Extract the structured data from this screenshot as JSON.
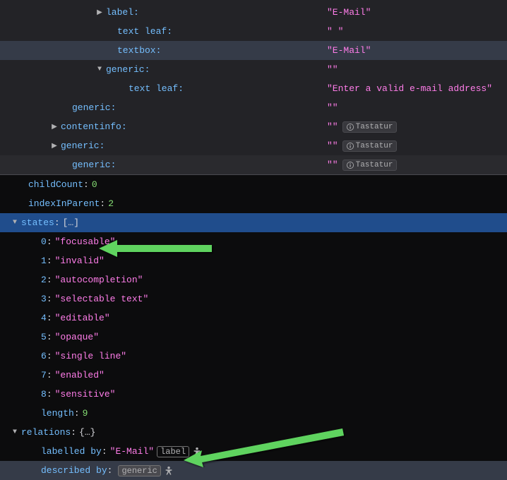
{
  "tree": [
    {
      "indent": 128,
      "twisty": "▶",
      "role": "label",
      "value": "\"E-Mail\"",
      "badge": null
    },
    {
      "indent": 144,
      "twisty": "",
      "role": "text leaf",
      "value": "\" \"",
      "badge": null
    },
    {
      "indent": 144,
      "twisty": "",
      "role": "textbox",
      "value": "\"E-Mail\"",
      "badge": null,
      "selected": true
    },
    {
      "indent": 128,
      "twisty": "▼",
      "role": "generic",
      "value": "\"\"",
      "badge": null
    },
    {
      "indent": 160,
      "twisty": "",
      "role": "text leaf",
      "value": "\"Enter a valid e-mail address\"",
      "badge": null
    },
    {
      "indent": 80,
      "twisty": "",
      "role": "generic",
      "value": "\"\"",
      "badge": null
    },
    {
      "indent": 64,
      "twisty": "▶",
      "role": "contentinfo",
      "value": "\"\"",
      "badge": "Tastatur"
    },
    {
      "indent": 64,
      "twisty": "▶",
      "role": "generic",
      "value": "\"\"",
      "badge": "Tastatur"
    },
    {
      "indent": 80,
      "twisty": "",
      "role": "generic",
      "value": "\"\"",
      "badge": "Tastatur",
      "faded": true
    }
  ],
  "props_top": [
    {
      "indent": 32,
      "key": "childCount",
      "value": "0",
      "vtype": "num"
    },
    {
      "indent": 32,
      "key": "indexInParent",
      "value": "2",
      "vtype": "num"
    }
  ],
  "states_header": {
    "twisty": "▼",
    "key": "states",
    "bracket": "[…]"
  },
  "states": [
    {
      "idx": "0",
      "val": "\"focusable\""
    },
    {
      "idx": "1",
      "val": "\"invalid\""
    },
    {
      "idx": "2",
      "val": "\"autocompletion\""
    },
    {
      "idx": "3",
      "val": "\"selectable text\""
    },
    {
      "idx": "4",
      "val": "\"editable\""
    },
    {
      "idx": "5",
      "val": "\"opaque\""
    },
    {
      "idx": "6",
      "val": "\"single line\""
    },
    {
      "idx": "7",
      "val": "\"enabled\""
    },
    {
      "idx": "8",
      "val": "\"sensitive\""
    }
  ],
  "length": {
    "key": "length",
    "value": "9"
  },
  "relations_header": {
    "twisty": "▼",
    "key": "relations",
    "brace": "{…}"
  },
  "relations": {
    "labelled_by": {
      "key": "labelled by",
      "value": "\"E-Mail\"",
      "chip": "label"
    },
    "described_by": {
      "key": "described by",
      "value": "",
      "chip": "generic"
    }
  }
}
